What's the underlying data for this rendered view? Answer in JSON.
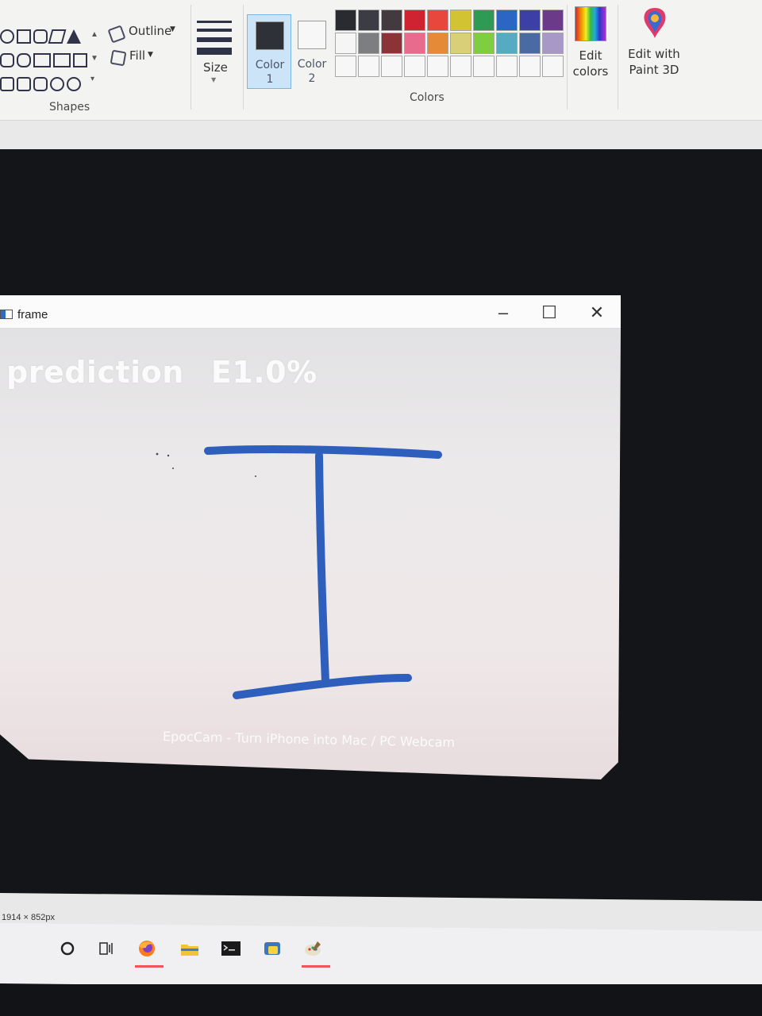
{
  "ribbon": {
    "shapes": {
      "outline_label": "Outline",
      "fill_label": "Fill",
      "group_label": "Shapes"
    },
    "size_label": "Size",
    "color1": {
      "line1": "Color",
      "line2": "1",
      "swatch": "#2f3139"
    },
    "color2": {
      "line1": "Color",
      "line2": "2",
      "swatch": "#f7f7f7"
    },
    "colors_group_label": "Colors",
    "palette": [
      "#2a2b30",
      "#3c3d44",
      "#433a40",
      "#cf2331",
      "#e8473e",
      "#d2c333",
      "#2f9a54",
      "#2b66c5",
      "#3b3fa6",
      "#6b3a88",
      "#f5f5f5",
      "#7d7e82",
      "#8b3337",
      "#e86b8e",
      "#e58a36",
      "#d8cf78",
      "#7fce42",
      "#56aac2",
      "#4a6aa4",
      "#a898c8",
      "#f7f7f7",
      "#f7f7f7",
      "#f7f7f7",
      "#f7f7f7",
      "#f7f7f7",
      "#f7f7f7",
      "#f7f7f7",
      "#f7f7f7",
      "#f7f7f7",
      "#f7f7f7"
    ],
    "edit_colors": {
      "line1": "Edit",
      "line2": "colors"
    },
    "edit_paint3d": {
      "line1": "Edit with",
      "line2": "Paint 3D"
    }
  },
  "window": {
    "title": "frame",
    "prediction_label": "prediction",
    "prediction_value": "E1.0%",
    "watermark": "EpocCam - Turn iPhone into Mac / PC Webcam",
    "ink_color": "#2f5fbd"
  },
  "status": {
    "dimensions": "1914 × 852px"
  },
  "taskbar": {
    "icons": [
      "search-circle-icon",
      "task-view-icon",
      "firefox-icon",
      "file-explorer-icon",
      "terminal-icon",
      "python-icon",
      "paint-icon"
    ]
  }
}
